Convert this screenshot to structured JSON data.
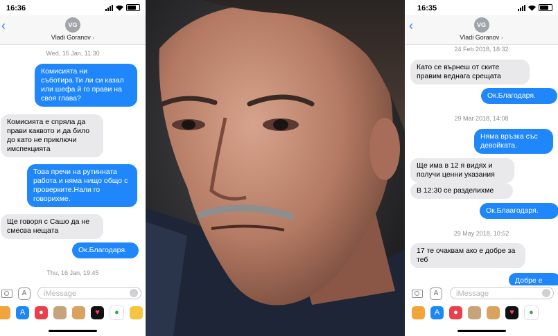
{
  "left": {
    "status_time": "16:36",
    "avatar_initials": "VG",
    "contact_name": "Vladi Goranov",
    "contact_chevron": "›",
    "timestamps": [
      {
        "day": "Wed, 15 Jan,",
        "time": "11:30"
      },
      {
        "day": "Thu, 16 Jan,",
        "time": "19:45"
      }
    ],
    "messages": [
      {
        "side": "out",
        "text": "Комисията ни съботира.Ти ли си казал или шефа й го прави на своя глава?"
      },
      {
        "side": "in",
        "text": "Комисията е спряла да прави каквото и да било до като не приключи имспекцията"
      },
      {
        "side": "out",
        "text": "Това пречи на рутинната работа и няма нищо общо с проверките.Нали го говорихме."
      },
      {
        "side": "in",
        "text": "Ще говоря с Сашо да не смесва нещата"
      },
      {
        "side": "out",
        "text": "Ок.Благодаря."
      }
    ],
    "imessage_placeholder": "iMessage"
  },
  "right": {
    "status_time": "16:35",
    "avatar_initials": "VG",
    "contact_name": "Vladi Goranov",
    "contact_chevron": "›",
    "timestamps": [
      {
        "day": "24 Feb 2018,",
        "time": "18:32"
      },
      {
        "day": "29 Mar 2018,",
        "time": "14:08"
      },
      {
        "day": "29 May 2018,",
        "time": "10:52"
      }
    ],
    "messages": [
      {
        "side": "in",
        "text": "Като се върнеш от ските правим веднага срещата"
      },
      {
        "side": "out",
        "text": "Ок.Благодаря."
      },
      {
        "side": "out",
        "text": "Няма връзка със девойката."
      },
      {
        "side": "in",
        "text": "Ще има в 12 я видях и получи ценни указания"
      },
      {
        "side": "in",
        "text": "В 12:30 се разделихме"
      },
      {
        "side": "out",
        "text": "Ок.Блаагодаря."
      },
      {
        "side": "in",
        "text": "17 те очаквам ако е добре за теб"
      },
      {
        "side": "out",
        "text": "Добре е"
      }
    ],
    "imessage_placeholder": "iMessage"
  },
  "icons": {
    "back": "‹",
    "app_tray": [
      "photos-icon",
      "appstore-icon",
      "search-images-icon",
      "memoji-icon",
      "monkey-icon",
      "heart-icon",
      "maps-icon",
      "extra-icon"
    ]
  },
  "colors": {
    "bubble_out": "#1f87fb",
    "bubble_in": "#e9e9eb",
    "accent": "#2d7cf6"
  }
}
